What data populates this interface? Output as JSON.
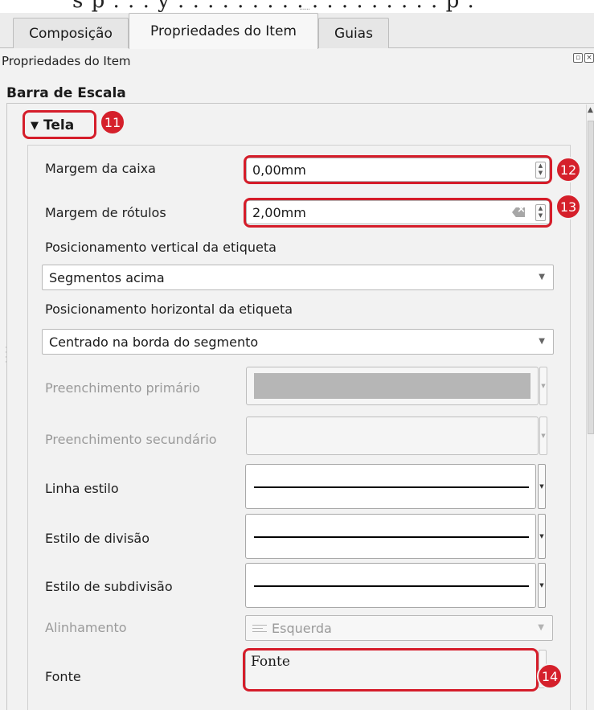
{
  "tabs": [
    {
      "label": "Composição",
      "active": false
    },
    {
      "label": "Propriedades do Item",
      "active": true
    },
    {
      "label": "Guias",
      "active": false
    }
  ],
  "panel": {
    "title": "Propriedades do Item",
    "section_title": "Barra de Escala"
  },
  "group": {
    "title": "Tela",
    "collapse_icon": "triangle-down-icon"
  },
  "fields": {
    "box_margin": {
      "label": "Margem da caixa",
      "value": "0,00mm"
    },
    "label_margin": {
      "label": "Margem de rótulos",
      "value": "2,00mm"
    },
    "vertical_placement": {
      "label": "Posicionamento vertical da etiqueta",
      "value": "Segmentos acima"
    },
    "horizontal_placement": {
      "label": "Posicionamento horizontal da etiqueta",
      "value": "Centrado na borda do segmento"
    },
    "primary_fill": {
      "label": "Preenchimento primário",
      "color": "#b6b6b6",
      "enabled": false
    },
    "secondary_fill": {
      "label": "Preenchimento secundário",
      "enabled": false
    },
    "line_style": {
      "label": "Linha estilo"
    },
    "division_style": {
      "label": "Estilo de divisão"
    },
    "subdivision_style": {
      "label": "Estilo de subdivisão"
    },
    "alignment": {
      "label": "Alinhamento",
      "value": "Esquerda",
      "enabled": false
    },
    "font": {
      "label": "Fonte",
      "value": "Fonte"
    }
  },
  "annotations": {
    "badge_11": "11",
    "badge_12": "12",
    "badge_13": "13",
    "badge_14": "14",
    "highlight_color": "#d51d2a"
  }
}
